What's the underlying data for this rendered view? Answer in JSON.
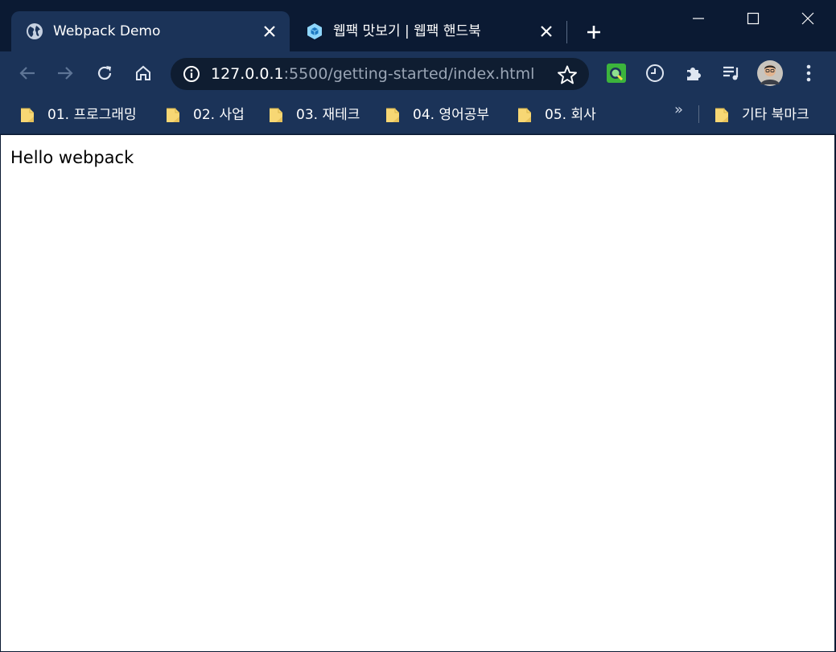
{
  "tabs": [
    {
      "title": "Webpack Demo",
      "favicon": "globe-icon",
      "active": true
    },
    {
      "title": "웹팩 맛보기 | 웹팩 핸드북",
      "favicon": "webpack-cube-icon",
      "active": false
    }
  ],
  "address": {
    "host": "127.0.0.1",
    "rest": ":5500/getting-started/index.html"
  },
  "bookmarks": [
    {
      "label": "01. 프로그래밍"
    },
    {
      "label": "02. 사업"
    },
    {
      "label": "03. 재테크"
    },
    {
      "label": "04. 영어공부"
    },
    {
      "label": "05. 회사"
    }
  ],
  "bookmarks_more": "»",
  "other_bookmarks": "기타 북마크",
  "page": {
    "text": "Hello webpack"
  },
  "colors": {
    "frame": "#0b1a33",
    "toolbar": "#1b3358",
    "omnibox": "#0f1d31",
    "folder": "#f7d774"
  }
}
